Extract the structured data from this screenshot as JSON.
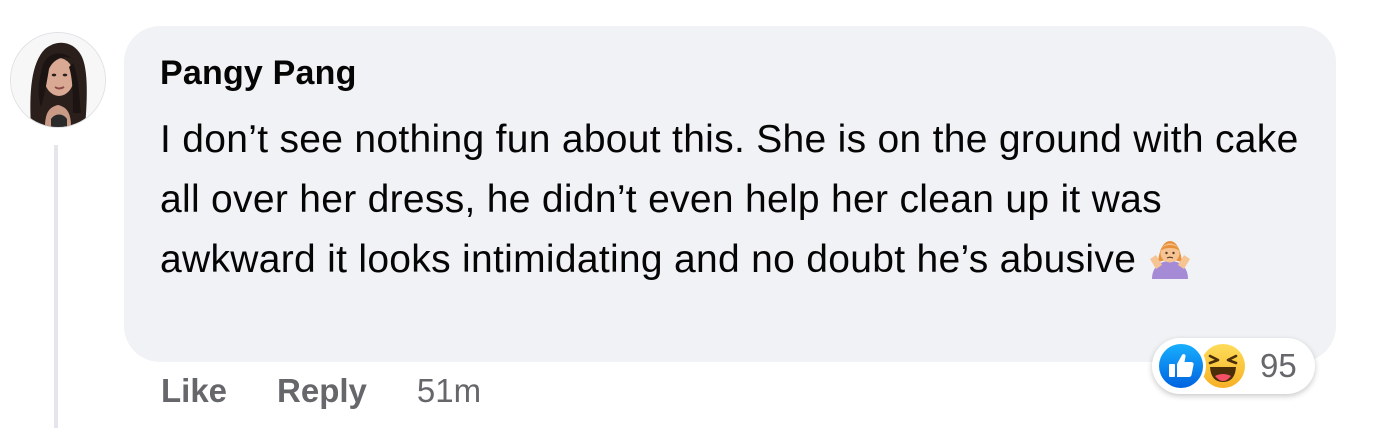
{
  "comment": {
    "author": "Pangy Pang",
    "text": "I don’t see nothing fun about this. She is on the ground with cake all over her dress, he didn’t even help her clean up it was awkward it looks intimidating and no doubt he’s abusive",
    "emoji": "person-gesturing-no-icon",
    "actions": {
      "like_label": "Like",
      "reply_label": "Reply",
      "timestamp": "51m"
    },
    "reactions": {
      "icons": [
        "like-icon",
        "haha-icon"
      ],
      "count": "95"
    }
  },
  "colors": {
    "bubble": "#f0f2f5",
    "text": "#050505",
    "secondary_text": "#65676b",
    "like_blue": "#1877f2",
    "haha_yellow": "#f7b125"
  }
}
